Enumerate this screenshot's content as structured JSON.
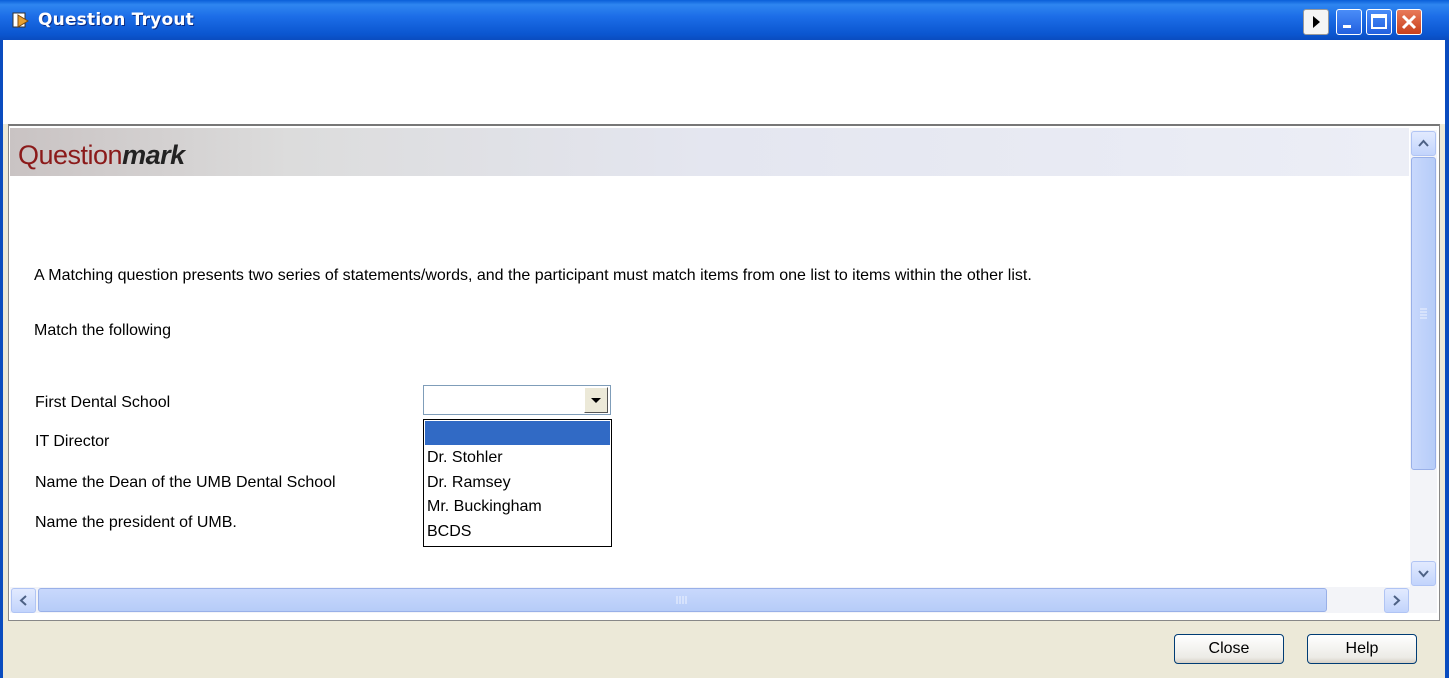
{
  "window": {
    "title": "Question Tryout"
  },
  "banner": {
    "logo_regular": "Question",
    "logo_bold": "mark",
    "logo_color": "#8b1a1a"
  },
  "content": {
    "intro": "A Matching question presents two series of statements/words, and the participant must match items from one list to items within the other list.",
    "instruction": "Match the following",
    "questions": [
      "First Dental School",
      "IT Director",
      "Name the Dean of the UMB Dental School",
      "Name the president of UMB."
    ],
    "select": {
      "selected_value": "",
      "options": [
        "",
        "Dr. Stohler",
        "Dr. Ramsey",
        "Mr. Buckingham",
        "BCDS"
      ],
      "highlight_color": "#316ac5"
    }
  },
  "footer": {
    "close_label": "Close",
    "help_label": "Help"
  },
  "colors": {
    "titlebar": "#0a4cbf",
    "window_bg": "#ece9d8"
  }
}
